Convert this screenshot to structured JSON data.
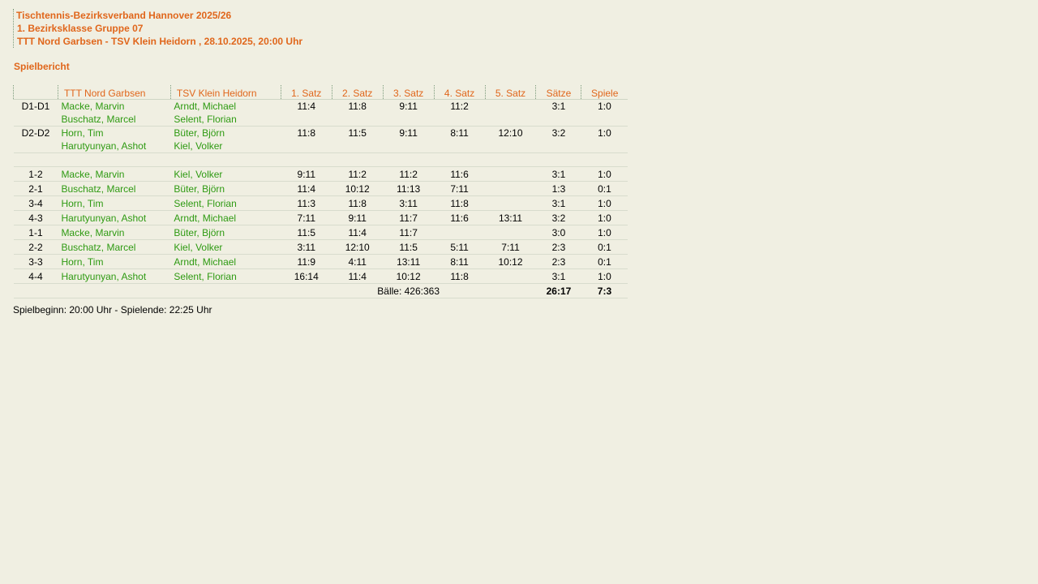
{
  "header": {
    "line1": "Tischtennis-Bezirksverband Hannover 2025/26",
    "line2": "1. Bezirksklasse Gruppe 07",
    "line3": "TTT Nord Garbsen - TSV Klein Heidorn , 28.10.2025, 20:00 Uhr"
  },
  "section_title": "Spielbericht",
  "columns": {
    "code": "",
    "home": "TTT Nord Garbsen",
    "away": "TSV Klein Heidorn",
    "s1": "1. Satz",
    "s2": "2. Satz",
    "s3": "3. Satz",
    "s4": "4. Satz",
    "s5": "5. Satz",
    "saetze": "Sätze",
    "spiele": "Spiele"
  },
  "doubles": [
    {
      "code": "D1-D1",
      "home1": "Macke, Marvin",
      "home2": "Buschatz, Marcel",
      "away1": "Arndt, Michael",
      "away2": "Selent, Florian",
      "s1": "11:4",
      "s2": "11:8",
      "s3": "9:11",
      "s4": "11:2",
      "s5": "",
      "saetze": "3:1",
      "spiele": "1:0"
    },
    {
      "code": "D2-D2",
      "home1": "Horn, Tim",
      "home2": "Harutyunyan, Ashot",
      "away1": "Büter, Björn",
      "away2": "Kiel, Volker",
      "s1": "11:8",
      "s2": "11:5",
      "s3": "9:11",
      "s4": "8:11",
      "s5": "12:10",
      "saetze": "3:2",
      "spiele": "1:0"
    }
  ],
  "singles": [
    {
      "code": "1-2",
      "home": "Macke, Marvin",
      "away": "Kiel, Volker",
      "s1": "9:11",
      "s2": "11:2",
      "s3": "11:2",
      "s4": "11:6",
      "s5": "",
      "saetze": "3:1",
      "spiele": "1:0"
    },
    {
      "code": "2-1",
      "home": "Buschatz, Marcel",
      "away": "Büter, Björn",
      "s1": "11:4",
      "s2": "10:12",
      "s3": "11:13",
      "s4": "7:11",
      "s5": "",
      "saetze": "1:3",
      "spiele": "0:1"
    },
    {
      "code": "3-4",
      "home": "Horn, Tim",
      "away": "Selent, Florian",
      "s1": "11:3",
      "s2": "11:8",
      "s3": "3:11",
      "s4": "11:8",
      "s5": "",
      "saetze": "3:1",
      "spiele": "1:0"
    },
    {
      "code": "4-3",
      "home": "Harutyunyan, Ashot",
      "away": "Arndt, Michael",
      "s1": "7:11",
      "s2": "9:11",
      "s3": "11:7",
      "s4": "11:6",
      "s5": "13:11",
      "saetze": "3:2",
      "spiele": "1:0"
    },
    {
      "code": "1-1",
      "home": "Macke, Marvin",
      "away": "Büter, Björn",
      "s1": "11:5",
      "s2": "11:4",
      "s3": "11:7",
      "s4": "",
      "s5": "",
      "saetze": "3:0",
      "spiele": "1:0"
    },
    {
      "code": "2-2",
      "home": "Buschatz, Marcel",
      "away": "Kiel, Volker",
      "s1": "3:11",
      "s2": "12:10",
      "s3": "11:5",
      "s4": "5:11",
      "s5": "7:11",
      "saetze": "2:3",
      "spiele": "0:1"
    },
    {
      "code": "3-3",
      "home": "Horn, Tim",
      "away": "Arndt, Michael",
      "s1": "11:9",
      "s2": "4:11",
      "s3": "13:11",
      "s4": "8:11",
      "s5": "10:12",
      "saetze": "2:3",
      "spiele": "0:1"
    },
    {
      "code": "4-4",
      "home": "Harutyunyan, Ashot",
      "away": "Selent, Florian",
      "s1": "16:14",
      "s2": "11:4",
      "s3": "10:12",
      "s4": "11:8",
      "s5": "",
      "saetze": "3:1",
      "spiele": "1:0"
    }
  ],
  "totals": {
    "baelle": "Bälle: 426:363",
    "saetze": "26:17",
    "spiele": "7:3"
  },
  "footer": "Spielbeginn: 20:00 Uhr - Spielende: 22:25 Uhr"
}
